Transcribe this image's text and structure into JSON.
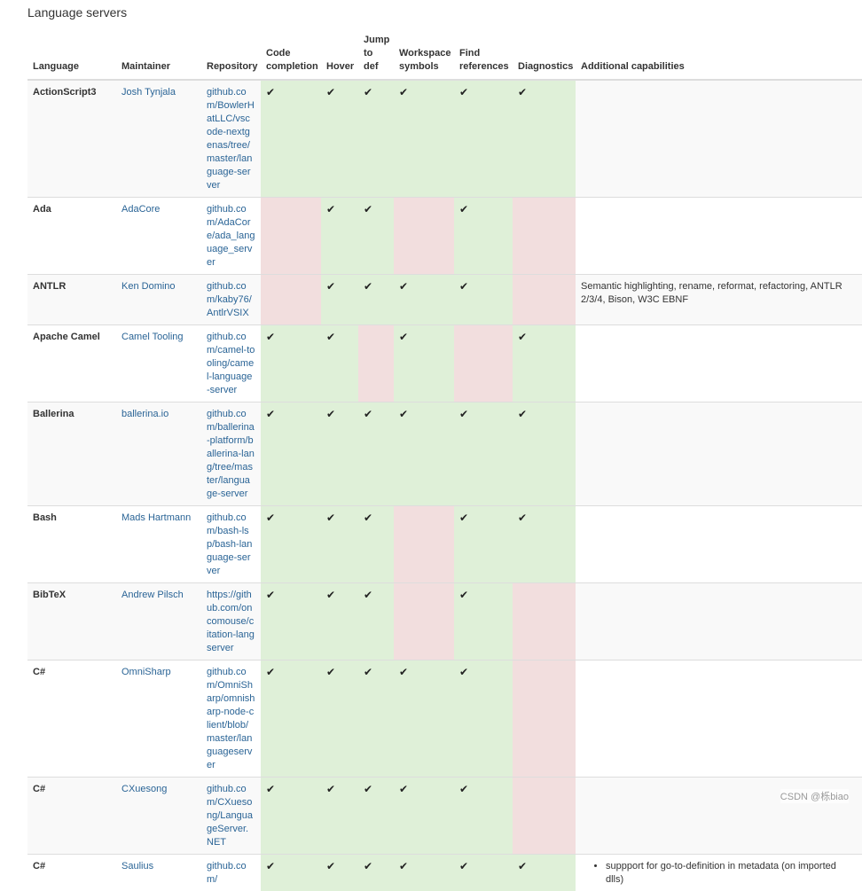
{
  "page": {
    "title": "Language servers"
  },
  "columns": [
    "Language",
    "Maintainer",
    "Repository",
    "Code completion",
    "Hover",
    "Jump to def",
    "Workspace symbols",
    "Find references",
    "Diagnostics",
    "Additional capabilities"
  ],
  "check_glyph": "✔",
  "colors": {
    "yes": "#dff0d8",
    "no": "#f2dede",
    "link": "#2a6496"
  },
  "rows": [
    {
      "language": "ActionScript3",
      "maintainer": "Josh Tynjala",
      "repo": "github.com/BowlerHatLLC/vscode-nextgenas/tree/master/language-server",
      "features": [
        true,
        true,
        true,
        true,
        true,
        true
      ],
      "additional": ""
    },
    {
      "language": "Ada",
      "maintainer": "AdaCore",
      "repo": "github.com/AdaCore/ada_language_server",
      "features": [
        false,
        true,
        true,
        false,
        true,
        false
      ],
      "additional": ""
    },
    {
      "language": "ANTLR",
      "maintainer": "Ken Domino",
      "repo": "github.com/kaby76/AntlrVSIX",
      "features": [
        false,
        true,
        true,
        true,
        true,
        false
      ],
      "additional": "Semantic highlighting, rename, reformat, refactoring, ANTLR 2/3/4, Bison, W3C EBNF"
    },
    {
      "language": "Apache Camel",
      "maintainer": "Camel Tooling",
      "repo": "github.com/camel-tooling/camel-language-server",
      "features": [
        true,
        true,
        false,
        true,
        false,
        true
      ],
      "additional": ""
    },
    {
      "language": "Ballerina",
      "maintainer": "ballerina.io",
      "repo": "github.com/ballerina-platform/ballerina-lang/tree/master/language-server",
      "features": [
        true,
        true,
        true,
        true,
        true,
        true
      ],
      "additional": ""
    },
    {
      "language": "Bash",
      "maintainer": "Mads Hartmann",
      "repo": "github.com/bash-lsp/bash-language-server",
      "features": [
        true,
        true,
        true,
        false,
        true,
        true
      ],
      "additional": ""
    },
    {
      "language": "BibTeX",
      "maintainer": "Andrew Pilsch",
      "repo": "https://github.com/oncomouse/citation-langserver",
      "features": [
        true,
        true,
        true,
        false,
        true,
        false
      ],
      "additional": ""
    },
    {
      "language": "C#",
      "maintainer": "OmniSharp",
      "repo": "github.com/OmniSharp/omnisharp-node-client/blob/master/languageserver",
      "features": [
        true,
        true,
        true,
        true,
        true,
        false
      ],
      "additional": ""
    },
    {
      "language": "C#",
      "maintainer": "CXuesong",
      "repo": "github.com/CXuesong/LanguageServer.NET",
      "features": [
        true,
        true,
        true,
        true,
        true,
        false
      ],
      "additional": ""
    },
    {
      "language": "C#",
      "maintainer": "Saulius",
      "repo": "github.com/",
      "features": [
        true,
        true,
        true,
        true,
        true,
        true
      ],
      "additional_list": [
        "suppport for go-to-definition in metadata (on imported dlls)"
      ]
    }
  ],
  "watermark": "CSDN @栎biao"
}
